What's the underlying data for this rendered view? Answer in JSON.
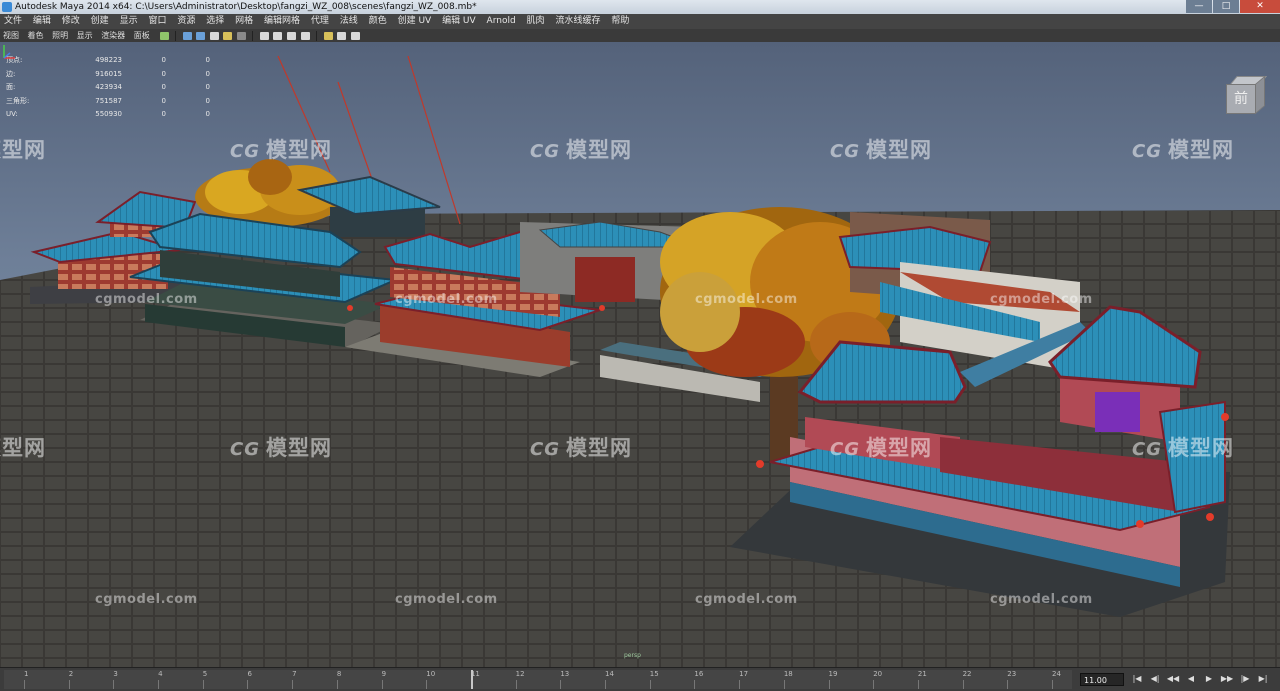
{
  "window": {
    "title": "Autodesk Maya 2014 x64: C:\\Users\\Administrator\\Desktop\\fangzi_WZ_008\\scenes\\fangzi_WZ_008.mb*",
    "minimize": "—",
    "maximize": "□",
    "close": "✕"
  },
  "menus": [
    "文件",
    "编辑",
    "修改",
    "创建",
    "显示",
    "窗口",
    "资源",
    "选择",
    "网格",
    "编辑网格",
    "代理",
    "法线",
    "颜色",
    "创建 UV",
    "编辑 UV",
    "Arnold",
    "肌肉",
    "流水线缓存",
    "帮助"
  ],
  "panel_menus": [
    "视图",
    "着色",
    "照明",
    "显示",
    "渲染器",
    "面板"
  ],
  "hud": {
    "rows": [
      {
        "label": "顶点:",
        "v1": "498223",
        "v2": "0",
        "v3": "0"
      },
      {
        "label": "边:",
        "v1": "916015",
        "v2": "0",
        "v3": "0"
      },
      {
        "label": "面:",
        "v1": "423934",
        "v2": "0",
        "v3": "0"
      },
      {
        "label": "三角形:",
        "v1": "751587",
        "v2": "0",
        "v3": "0"
      },
      {
        "label": "UV:",
        "v1": "550930",
        "v2": "0",
        "v3": "0"
      }
    ]
  },
  "viewcube": {
    "face_label": "前"
  },
  "watermark": {
    "brand": "模型网",
    "site": "cgmodel.com",
    "mark": "CG"
  },
  "viewport_label": "persp",
  "timeline": {
    "ticks": [
      "1",
      "2",
      "3",
      "4",
      "5",
      "6",
      "7",
      "8",
      "9",
      "10",
      "11",
      "12",
      "13",
      "14",
      "15",
      "16",
      "17",
      "18",
      "19",
      "20",
      "21",
      "22",
      "23",
      "24"
    ],
    "current_frame": "11.00",
    "buttons": [
      "|◀",
      "◀|",
      "◀◀",
      "◀",
      "▶",
      "▶▶",
      "|▶",
      "▶|"
    ]
  }
}
